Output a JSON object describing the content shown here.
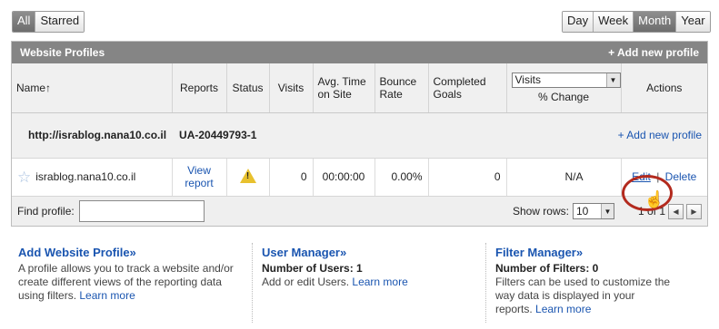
{
  "filter_toggle": {
    "all": "All",
    "starred": "Starred"
  },
  "range_toggle": {
    "day": "Day",
    "week": "Week",
    "month": "Month",
    "year": "Year"
  },
  "panel": {
    "title": "Website Profiles",
    "add_profile": "+ Add new profile"
  },
  "columns": {
    "name": "Name",
    "name_sort_icon": "↑",
    "reports": "Reports",
    "status": "Status",
    "visits": "Visits",
    "avg_time_1": "Avg. Time",
    "avg_time_2": "on Site",
    "bounce_1": "Bounce",
    "bounce_2": "Rate",
    "goals_1": "Completed",
    "goals_2": "Goals",
    "metric_selected": "Visits",
    "percent_change": "% Change",
    "actions": "Actions"
  },
  "account": {
    "url": "http://israblog.nana10.co.il",
    "id": "UA-20449793-1",
    "add_profile": "+ Add new profile"
  },
  "profile": {
    "name": "israblog.nana10.co.il",
    "report_1": "View",
    "report_2": "report",
    "status_icon": "warning-icon",
    "visits": "0",
    "avg_time": "00:00:00",
    "bounce_rate": "0.00%",
    "goals": "0",
    "change": "N/A",
    "edit": "Edit",
    "separator": "|",
    "delete": "Delete"
  },
  "footer": {
    "find_label": "Find profile:",
    "find_value": "",
    "rows_label": "Show rows:",
    "rows_value": "10",
    "page_info": "1 of 1"
  },
  "info": {
    "website": {
      "title": "Add Website Profile»",
      "line_1": "A profile allows you to track a website and/or",
      "line_2": "create different views of the reporting data",
      "line_3": "using filters.",
      "learn_more": "Learn more"
    },
    "users": {
      "title": "User Manager»",
      "stat": "Number of Users: 1",
      "line_1": "Add or edit Users.",
      "learn_more": "Learn more"
    },
    "filters": {
      "title": "Filter Manager»",
      "stat": "Number of Filters: 0",
      "line_1": "Filters can be used to customize the",
      "line_2": "way data is displayed in your",
      "line_3": "reports.",
      "learn_more": "Learn more"
    }
  },
  "colors": {
    "link": "#1a55b0",
    "header_bar": "#858585",
    "highlight_ring": "#b32a1e",
    "warning": "#e8c12e"
  }
}
